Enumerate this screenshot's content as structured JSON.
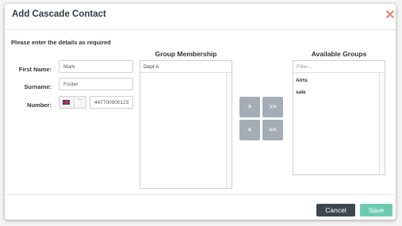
{
  "dialog": {
    "title": "Add Cascade Contact",
    "close_icon": "close-x-icon",
    "instructions": "Please enter the details as required"
  },
  "form": {
    "first_name": {
      "label": "First Name:",
      "value": "Mark"
    },
    "surname": {
      "label": "Surname:",
      "value": "Foster"
    },
    "number": {
      "label": "Number:",
      "country_icon": "uk-flag-icon",
      "value": "447700900123"
    }
  },
  "group_membership": {
    "title": "Group Membership",
    "items": [
      "Dept A"
    ]
  },
  "available_groups": {
    "title": "Available Groups",
    "filter_placeholder": "Filter...",
    "items": [
      "Airts",
      "sale"
    ]
  },
  "move_buttons": {
    "add_one": ">",
    "add_all": ">>",
    "remove_one": "<",
    "remove_all": "<<"
  },
  "footer": {
    "cancel_label": "Cancel",
    "save_label": "Save",
    "colors": {
      "cancel": "#3b4650",
      "save": "#6ecbb0"
    }
  }
}
